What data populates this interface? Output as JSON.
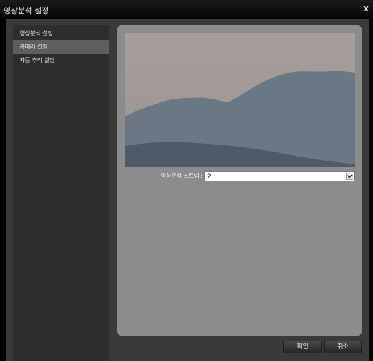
{
  "window": {
    "title": "영상분석 설정",
    "close_label": "x"
  },
  "sidebar": {
    "items": [
      {
        "label": "영상분석 설정",
        "active": false
      },
      {
        "label": "카메라 설정",
        "active": true
      },
      {
        "label": "자동 추적 설정",
        "active": false
      }
    ]
  },
  "stream": {
    "label": "영상분석 스트림 :",
    "value": "2"
  },
  "buttons": {
    "ok": "확인",
    "cancel": "취소"
  },
  "colors": {
    "panel": "#8c8c8c",
    "sidebar": "#2d2d2d",
    "active_item": "#5e5e5e"
  }
}
